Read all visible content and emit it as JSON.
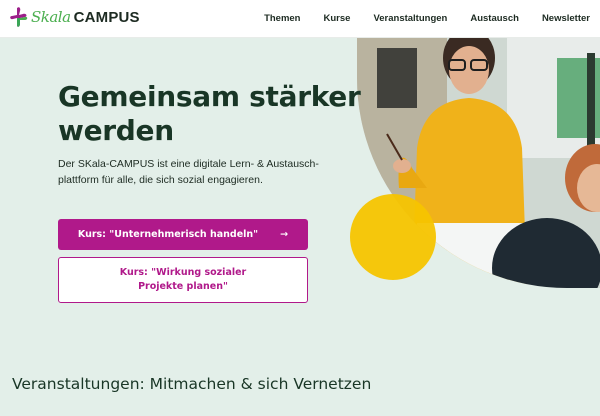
{
  "logo": {
    "script": "Skala",
    "word": "CAMPUS"
  },
  "nav": {
    "items": [
      "Themen",
      "Kurse",
      "Veranstaltungen",
      "Austausch",
      "Newsletter"
    ]
  },
  "hero": {
    "title": "Gemeinsam stärker werden",
    "lead": "Der SKala-CAMPUS ist eine digitale Lern- & Austausch-plattform für alle, die sich sozial engagieren.",
    "primary_button": "Kurs: \"Unternehmerisch handeln\"",
    "primary_arrow": "→",
    "secondary_button": "Kurs: \"Wirkung sozialer Projekte planen\""
  },
  "section": {
    "heading": "Veranstaltungen: Mitmachen & sich Vernetzen"
  },
  "colors": {
    "brand": "#b0198a",
    "dark_green": "#193626",
    "hero_bg": "#e3efe9",
    "accent_yellow": "#f5c400",
    "logo_green": "#4caf50"
  }
}
